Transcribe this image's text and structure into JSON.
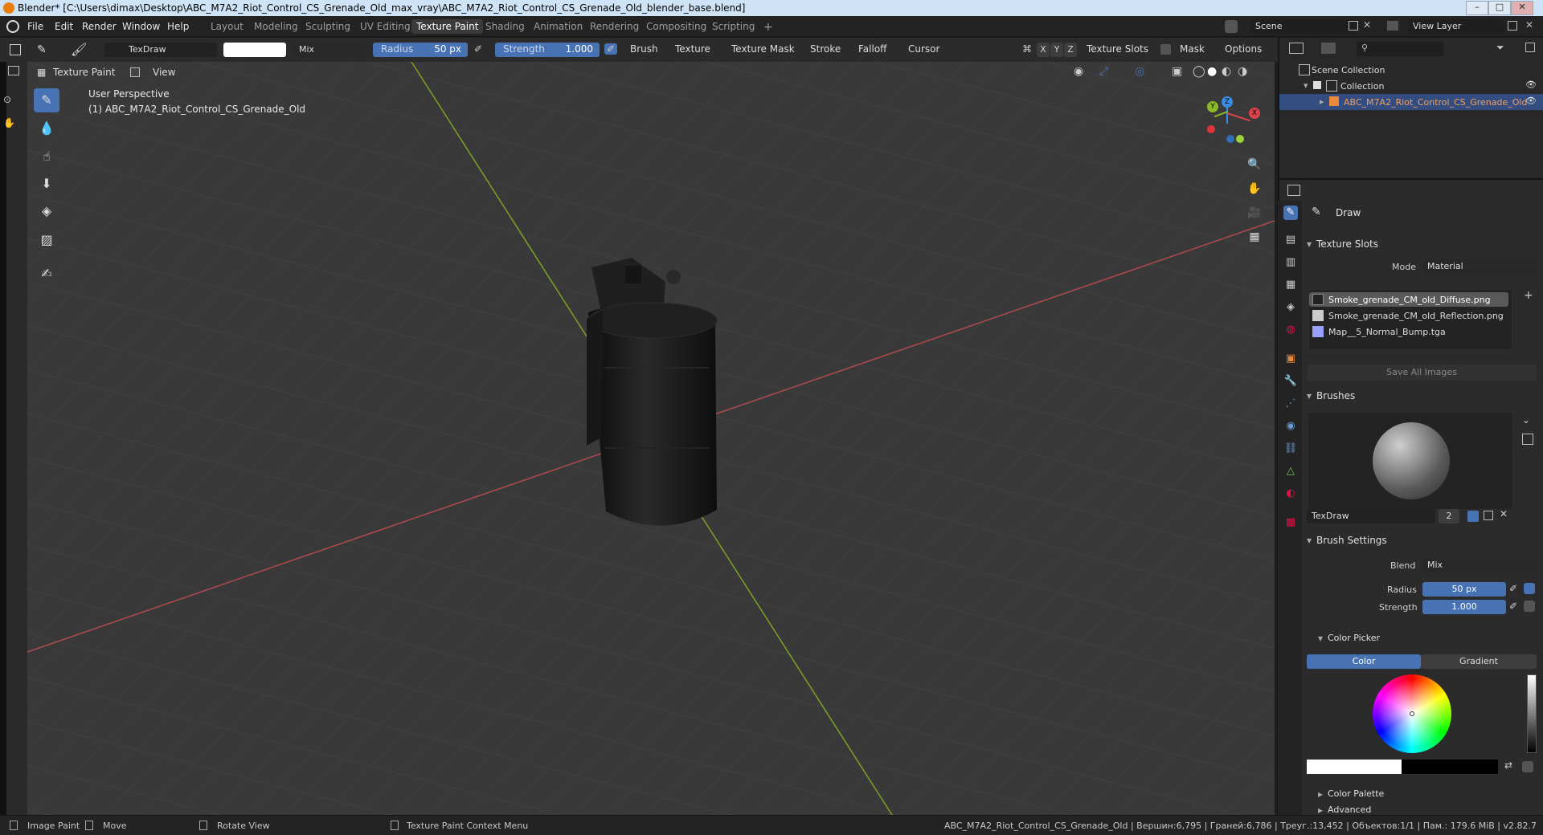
{
  "window": {
    "title": "Blender* [C:\\Users\\dimax\\Desktop\\ABC_M7A2_Riot_Control_CS_Grenade_Old_max_vray\\ABC_M7A2_Riot_Control_CS_Grenade_Old_blender_base.blend]",
    "minimize": "–",
    "maximize": "□",
    "close": "✕"
  },
  "menu": {
    "file": "File",
    "edit": "Edit",
    "render": "Render",
    "window": "Window",
    "help": "Help"
  },
  "workspaces": [
    "Layout",
    "Modeling",
    "Sculpting",
    "UV Editing",
    "Texture Paint",
    "Shading",
    "Animation",
    "Rendering",
    "Compositing",
    "Scripting",
    "+"
  ],
  "active_workspace": "Texture Paint",
  "scene": {
    "name": "Scene",
    "view_layer": "View Layer"
  },
  "toolheader": {
    "brush_name": "TexDraw",
    "blend": "Mix",
    "radius_label": "Radius",
    "radius_value": "50 px",
    "strength_label": "Strength",
    "strength_value": "1.000",
    "menus": [
      "Brush",
      "Texture",
      "Texture Mask",
      "Stroke",
      "Falloff",
      "Cursor"
    ],
    "axes": [
      "X",
      "Y",
      "Z"
    ],
    "texture_slots": "Texture Slots",
    "mask": "Mask",
    "options": "Options"
  },
  "viewport_header": {
    "mode": "Texture Paint",
    "view": "View"
  },
  "viewport": {
    "perspective": "User Perspective",
    "object_label": "(1) ABC_M7A2_Riot_Control_CS_Grenade_Old",
    "gizmo": {
      "x": "X",
      "y": "Y",
      "z": "Z"
    }
  },
  "outliner": {
    "scene_collection": "Scene Collection",
    "collection": "Collection",
    "object": "ABC_M7A2_Riot_Control_CS_Grenade_Old"
  },
  "properties": {
    "tool_name": "Draw",
    "texture_slots": {
      "header": "Texture Slots",
      "mode_label": "Mode",
      "mode_value": "Material",
      "slots": [
        "Smoke_grenade_CM_old_Diffuse.png",
        "Smoke_grenade_CM_old_Reflection.png",
        "Map__5_Normal_Bump.tga"
      ],
      "save_all": "Save All Images"
    },
    "brushes": {
      "header": "Brushes",
      "brush_name": "TexDraw",
      "users": "2"
    },
    "brush_settings": {
      "header": "Brush Settings",
      "blend_label": "Blend",
      "blend_value": "Mix",
      "radius_label": "Radius",
      "radius_value": "50 px",
      "strength_label": "Strength",
      "strength_value": "1.000"
    },
    "color_picker": {
      "header": "Color Picker",
      "tab_color": "Color",
      "tab_gradient": "Gradient"
    },
    "color_palette": "Color Palette",
    "advanced": "Advanced"
  },
  "statusbar": {
    "image_paint": "Image Paint",
    "move": "Move",
    "rotate_view": "Rotate View",
    "context_menu": "Texture Paint Context Menu",
    "stats": "ABC_M7A2_Riot_Control_CS_Grenade_Old | Вершин:6,795 | Граней:6,786 | Треуг.:13,452 | Объектов:1/1 | Пам.: 179.6 MiB | v2.82.7"
  },
  "colors": {
    "accent": "#4772b3",
    "x_axis": "#d9434a",
    "y_axis": "#8ab92a",
    "z_axis": "#3b8ce4",
    "selection": "#334d80"
  },
  "icons": [
    "blender-logo-icon",
    "paint-brush-icon",
    "eye-icon",
    "search-icon",
    "filter-icon",
    "zoom-icon",
    "hand-icon",
    "camera-icon",
    "grid-icon"
  ]
}
